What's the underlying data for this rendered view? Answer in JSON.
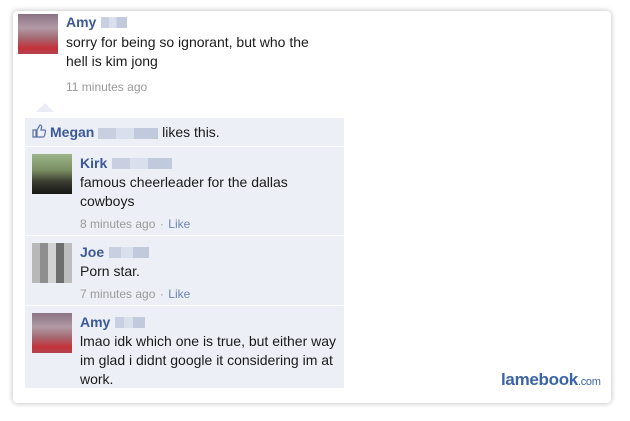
{
  "post": {
    "author": "Amy",
    "text": "sorry for being so ignorant, but who the hell is kim jong",
    "time": "11 minutes ago"
  },
  "likes": {
    "name": "Megan",
    "suffix": "likes this.",
    "icon": "thumbs-up-icon"
  },
  "comments": [
    {
      "author": "Kirk",
      "text": "famous cheerleader for the dallas cowboys",
      "time": "8 minutes ago",
      "sep": "·",
      "like": "Like"
    },
    {
      "author": "Joe",
      "text": "Porn star.",
      "time": "7 minutes ago",
      "sep": "·",
      "like": "Like"
    },
    {
      "author": "Amy",
      "text": "lmao idk which one is true, but either way im glad i didnt google it considering im at work."
    }
  ],
  "watermark": {
    "brand": "lamebook",
    "tld": ".com"
  },
  "colors": {
    "name": "#3b5998",
    "comment_bg": "#eceff5",
    "meta": "#999999",
    "link": "#6d84b4"
  }
}
